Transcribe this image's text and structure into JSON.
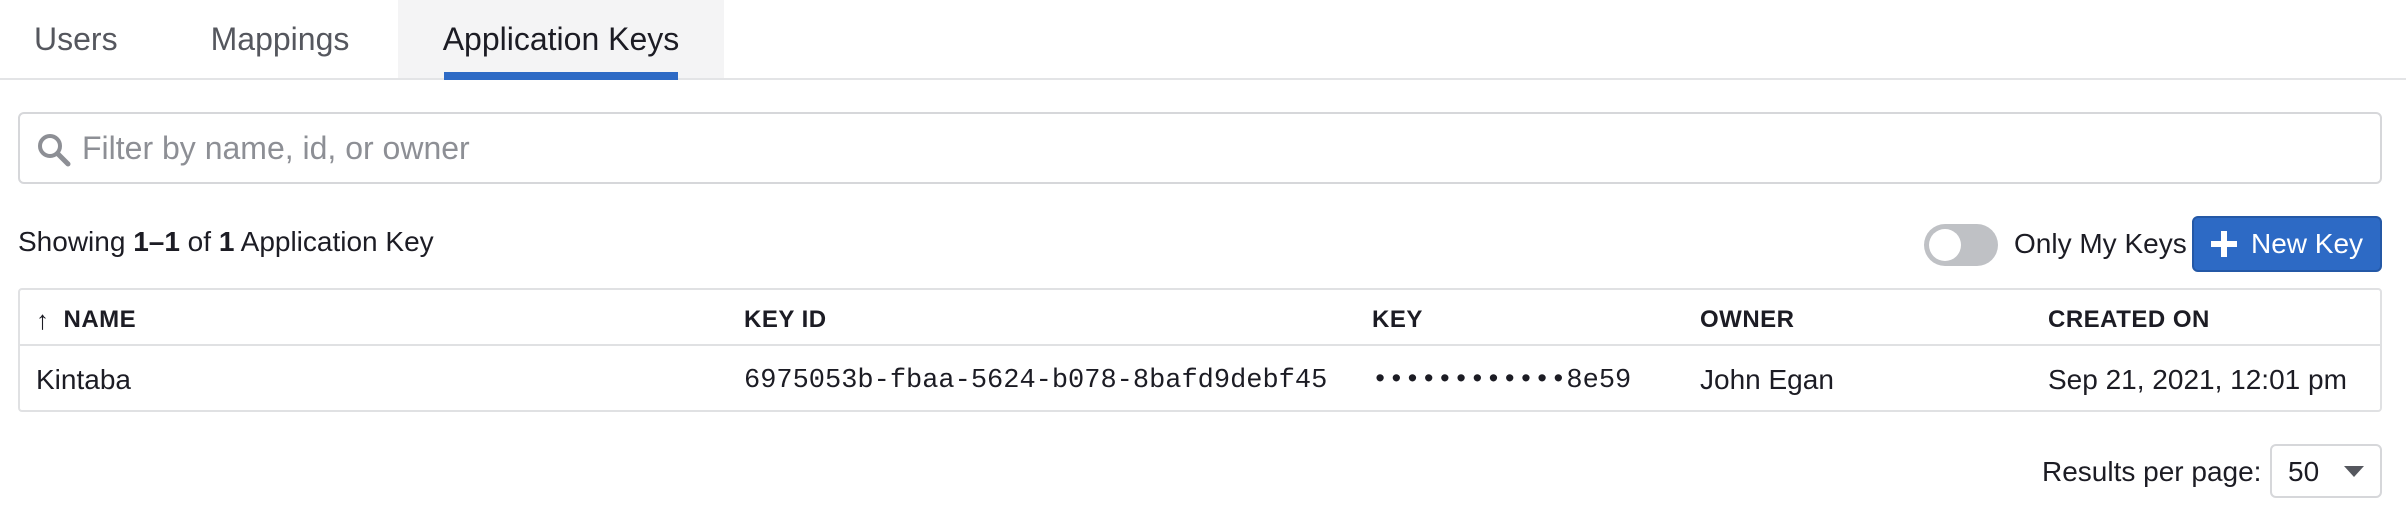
{
  "tabs": [
    {
      "label": "Users"
    },
    {
      "label": "Mappings"
    },
    {
      "label": "Application Keys",
      "active": true
    }
  ],
  "search": {
    "placeholder": "Filter by name, id, or owner",
    "icon": "search-icon"
  },
  "summary": {
    "prefix": "Showing ",
    "range": "1–1",
    "of": " of ",
    "total": "1",
    "suffix": " Application Key"
  },
  "toggle": {
    "label": "Only My Keys",
    "on": false
  },
  "new_key_button": {
    "label": "New Key",
    "icon": "plus-icon"
  },
  "table": {
    "columns": [
      "NAME",
      "KEY ID",
      "KEY",
      "OWNER",
      "CREATED ON"
    ],
    "sort": {
      "column": "NAME",
      "direction": "ascending"
    },
    "rows": [
      {
        "name": "Kintaba",
        "key_id": "6975053b-fbaa-5624-b078-8bafd9debf45",
        "key": "••••••••••••8e59",
        "owner": "John Egan",
        "created_on": "Sep 21, 2021, 12:01 pm"
      }
    ]
  },
  "pagination": {
    "label": "Results per page:",
    "value": "50"
  },
  "colors": {
    "accent": "#2d6ac5",
    "border": "#e0e1e3",
    "toggle_off": "#bfc1c5"
  }
}
